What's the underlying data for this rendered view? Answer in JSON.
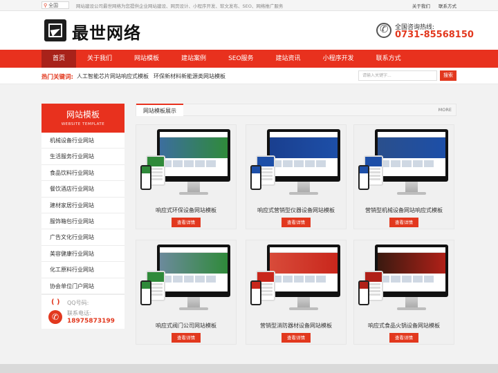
{
  "topbar": {
    "location": "全国",
    "tagline": "网站建设公司最世网络为您提供企业网站建设、网页设计、小程序开发、软文发布、SEO、网络推广服务",
    "links": [
      "关于我们",
      "联系方式"
    ]
  },
  "header": {
    "logo_text": "最世网络",
    "hotline_label": "全国咨询热线:",
    "hotline_number": "0731-85568150"
  },
  "nav": {
    "items": [
      "首页",
      "关于我们",
      "网站模板",
      "建站案例",
      "SEO服务",
      "建站资讯",
      "小程序开发",
      "联系方式"
    ],
    "active": "首页"
  },
  "hotbar": {
    "label": "热门关键词:",
    "keywords": [
      "人工智能芯片网站响应式模板",
      "环保新材料新能源类网站模板"
    ],
    "search_placeholder": "请输入关键字...",
    "search_button": "搜索"
  },
  "sidebar": {
    "title": "网站模板",
    "subtitle": "WEBSITE TEMPLATE",
    "items": [
      "机械设备行业网站",
      "生活服务行业网站",
      "食品饮料行业网站",
      "餐饮酒店行业网站",
      "建材家居行业网站",
      "服饰箱包行业网站",
      "广告文化行业网站",
      "美容健康行业网站",
      "化工原料行业网站",
      "协会单位门户网站"
    ],
    "qq_label": "QQ号码:",
    "tel_label": "联系电话:",
    "tel_number": "18975873199"
  },
  "main": {
    "title": "网站模板展示",
    "more": "MORE",
    "button_label": "查看详情",
    "cards": [
      {
        "caption": "响应式环保设备网站模板",
        "accent": "#2f8a3a",
        "banner": "#3c6e9e"
      },
      {
        "caption": "响应式营销型仪器设备网站模板",
        "accent": "#1d4fa8",
        "banner": "#1a3f8f"
      },
      {
        "caption": "营销型机械设备网站响应式模板",
        "accent": "#1d4fa8",
        "banner": "#2a4f8c"
      },
      {
        "caption": "响应式阀门公司网站模板",
        "accent": "#2f8a3a",
        "banner": "#6c8a9c"
      },
      {
        "caption": "营销型消防器材设备网站模板",
        "accent": "#c9271c",
        "banner": "#d84b3a"
      },
      {
        "caption": "响应式食品火锅设备网站模板",
        "accent": "#b02018",
        "banner": "#3a1a10"
      }
    ]
  },
  "colors": {
    "brand_red": "#e8311e",
    "nav_active": "#a8221a"
  },
  "icons": [
    "location-pin-icon",
    "logo-mark-icon",
    "phone-hotline-icon",
    "qq-icon",
    "telephone-icon"
  ]
}
